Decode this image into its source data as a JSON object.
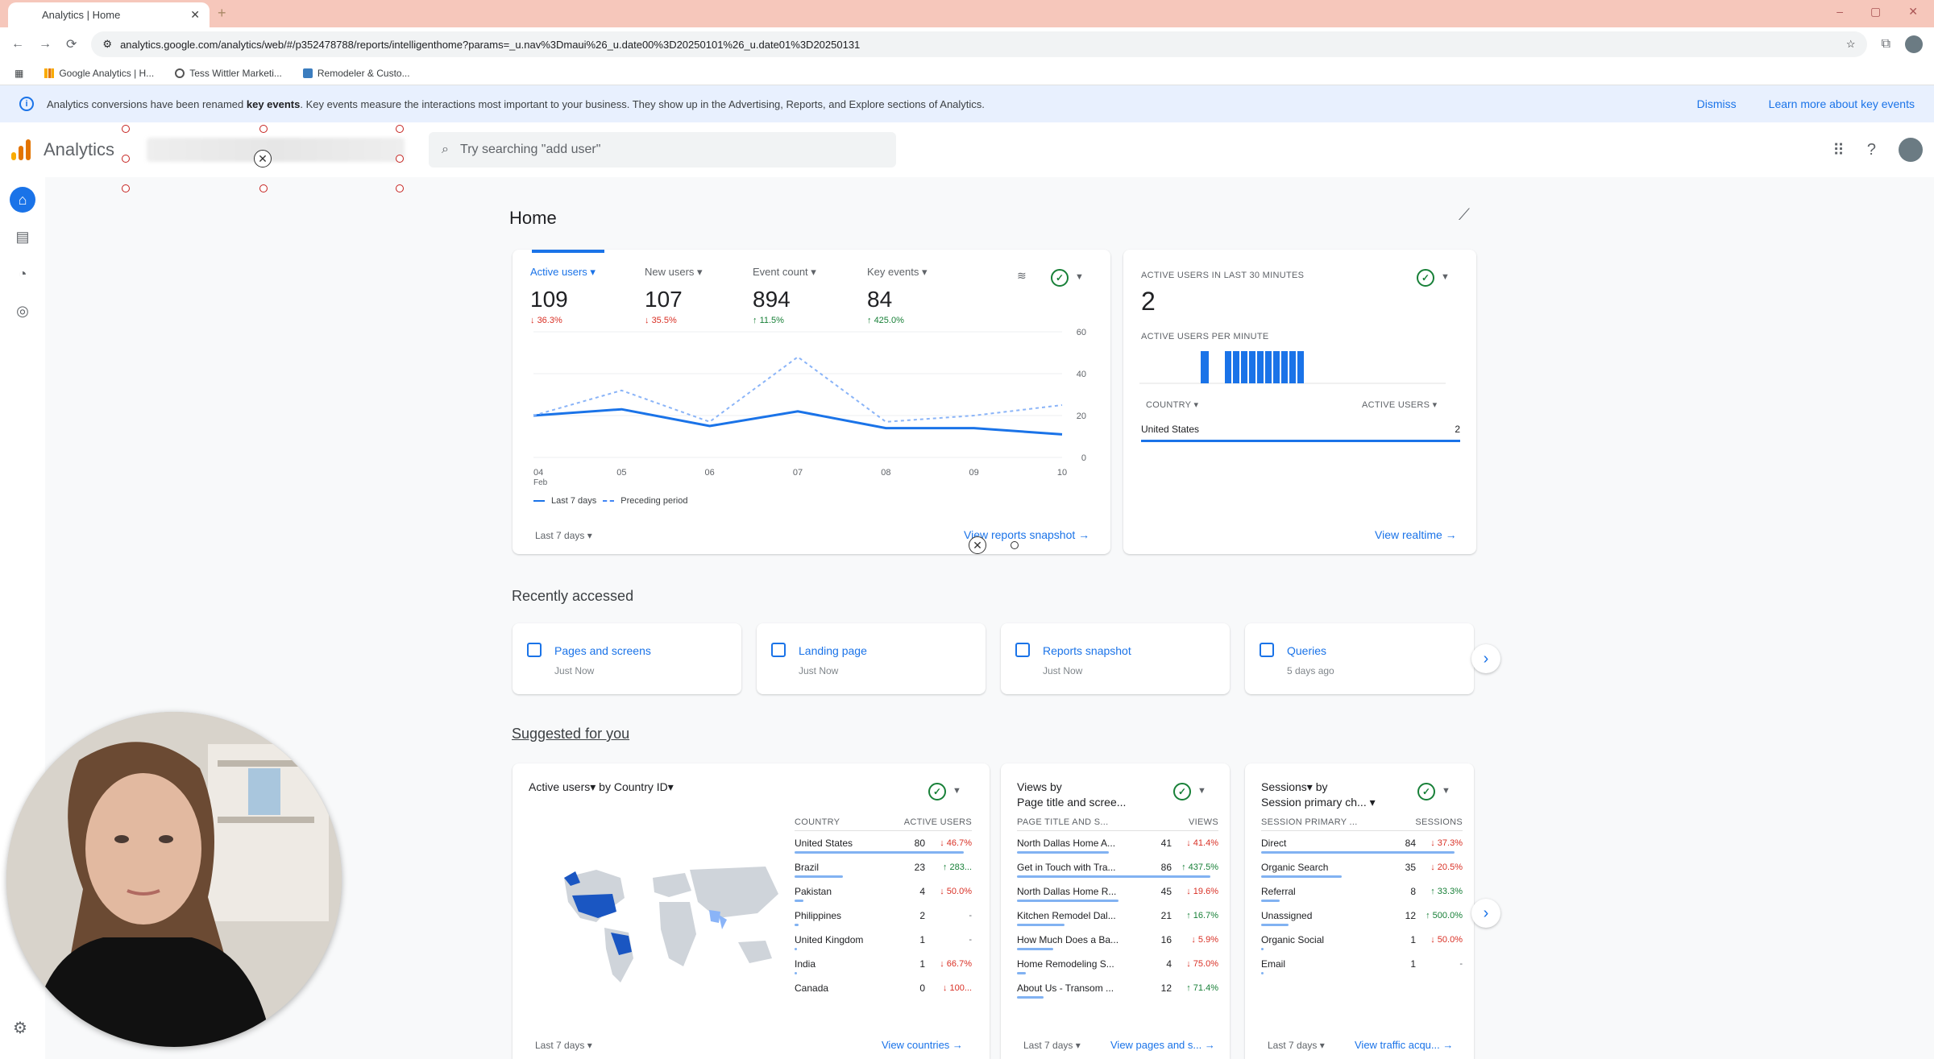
{
  "browser": {
    "tab_title": "Analytics | Home",
    "url": "analytics.google.com/analytics/web/#/p352478788/reports/intelligenthome?params=_u.nav%3Dmaui%26_u.date00%3D20250101%26_u.date01%3D20250131",
    "bookmarks": [
      "Google Analytics | H...",
      "Tess Wittler Marketi...",
      "Remodeler & Custo..."
    ]
  },
  "banner": {
    "text_before": "Analytics conversions have been renamed ",
    "text_bold": "key events",
    "text_after": ". Key events measure the interactions most important to your business. They show up in the Advertising, Reports, and Explore sections of Analytics.",
    "dismiss": "Dismiss",
    "learn_more": "Learn more about key events"
  },
  "header": {
    "app_title": "Analytics",
    "search_placeholder": "Try searching \"add user\""
  },
  "page": {
    "title": "Home"
  },
  "overview": {
    "metrics": [
      {
        "label": "Active users",
        "value": "109",
        "change": "36.3%",
        "dir": "down"
      },
      {
        "label": "New users",
        "value": "107",
        "change": "35.5%",
        "dir": "down"
      },
      {
        "label": "Event count",
        "value": "894",
        "change": "11.5%",
        "dir": "up"
      },
      {
        "label": "Key events",
        "value": "84",
        "change": "425.0%",
        "dir": "up"
      }
    ],
    "legend_current": "Last 7 days",
    "legend_previous": "Preceding period",
    "date_range": "Last 7 days",
    "link": "View reports snapshot"
  },
  "chart_data": {
    "type": "line",
    "x": [
      "04 Feb",
      "05",
      "06",
      "07",
      "08",
      "09",
      "10"
    ],
    "series": [
      {
        "name": "Last 7 days",
        "values": [
          20,
          23,
          15,
          22,
          14,
          14,
          11
        ]
      },
      {
        "name": "Preceding period",
        "values": [
          20,
          32,
          17,
          48,
          17,
          20,
          25
        ]
      }
    ],
    "ylim": [
      0,
      60
    ],
    "yticks": [
      "60",
      "40",
      "20",
      "0"
    ],
    "xticks_top": [
      "04",
      "05",
      "06",
      "07",
      "08",
      "09",
      "10"
    ],
    "xtick_sub": "Feb"
  },
  "realtime": {
    "label": "ACTIVE USERS IN LAST 30 MINUTES",
    "value": "2",
    "per_minute_label": "ACTIVE USERS PER MINUTE",
    "col_country": "COUNTRY",
    "col_users": "ACTIVE USERS",
    "row_country": "United States",
    "row_value": "2",
    "link": "View realtime"
  },
  "recent": {
    "title": "Recently accessed",
    "items": [
      {
        "name": "Pages and screens",
        "time": "Just Now"
      },
      {
        "name": "Landing page",
        "time": "Just Now"
      },
      {
        "name": "Reports snapshot",
        "time": "Just Now"
      },
      {
        "name": "Queries",
        "time": "5 days ago"
      }
    ]
  },
  "suggested": {
    "title": "Suggested for you",
    "countries": {
      "title": "Active users▾ by Country ID▾",
      "col1": "COUNTRY",
      "col2": "ACTIVE USERS",
      "rows": [
        {
          "name": "United States",
          "value": "80",
          "change": "↓ 46.7%"
        },
        {
          "name": "Brazil",
          "value": "23",
          "change": "↑ 283..."
        },
        {
          "name": "Pakistan",
          "value": "4",
          "change": "↓ 50.0%"
        },
        {
          "name": "Philippines",
          "value": "2",
          "change": "-"
        },
        {
          "name": "United Kingdom",
          "value": "1",
          "change": "-"
        },
        {
          "name": "India",
          "value": "1",
          "change": "↓ 66.7%"
        },
        {
          "name": "Canada",
          "value": "0",
          "change": "↓ 100..."
        }
      ],
      "date": "Last 7 days",
      "link": "View countries"
    },
    "pages": {
      "title_line1": "Views by",
      "title_line2": "Page title and scree...",
      "col1": "PAGE TITLE AND S...",
      "col2": "VIEWS",
      "rows": [
        {
          "name": "North Dallas Home A...",
          "value": "41",
          "change": "↓ 41.4%"
        },
        {
          "name": "Get in Touch with Tra...",
          "value": "86",
          "change": "↑ 437.5%"
        },
        {
          "name": "North Dallas Home R...",
          "value": "45",
          "change": "↓ 19.6%"
        },
        {
          "name": "Kitchen Remodel Dal...",
          "value": "21",
          "change": "↑ 16.7%"
        },
        {
          "name": "How Much Does a Ba...",
          "value": "16",
          "change": "↓ 5.9%"
        },
        {
          "name": "Home Remodeling S...",
          "value": "4",
          "change": "↓ 75.0%"
        },
        {
          "name": "About Us - Transom ...",
          "value": "12",
          "change": "↑ 71.4%"
        }
      ],
      "date": "Last 7 days",
      "link": "View pages and s..."
    },
    "sessions": {
      "title_line1": "Sessions▾ by",
      "title_line2": "Session primary ch...",
      "col1": "SESSION PRIMARY ...",
      "col2": "SESSIONS",
      "rows": [
        {
          "name": "Direct",
          "value": "84",
          "change": "↓ 37.3%"
        },
        {
          "name": "Organic Search",
          "value": "35",
          "change": "↓ 20.5%"
        },
        {
          "name": "Referral",
          "value": "8",
          "change": "↑ 33.3%"
        },
        {
          "name": "Unassigned",
          "value": "12",
          "change": "↑ 500.0%"
        },
        {
          "name": "Organic Social",
          "value": "1",
          "change": "↓ 50.0%"
        },
        {
          "name": "Email",
          "value": "1",
          "change": "-"
        }
      ],
      "date": "Last 7 days",
      "link": "View traffic acqu..."
    }
  },
  "colors": {
    "accent": "#1a73e8",
    "up": "#188038",
    "down": "#d93025"
  }
}
